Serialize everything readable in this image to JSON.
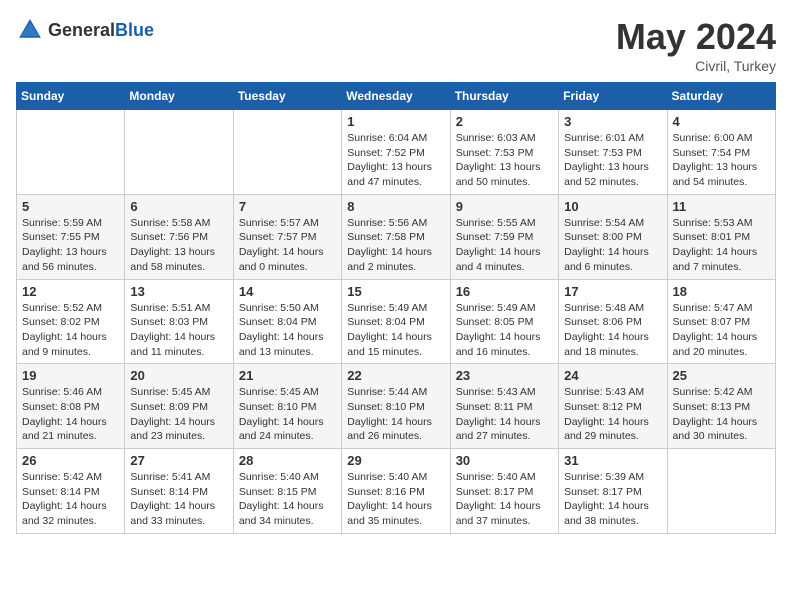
{
  "header": {
    "logo_general": "General",
    "logo_blue": "Blue",
    "month_year": "May 2024",
    "location": "Civril, Turkey"
  },
  "weekdays": [
    "Sunday",
    "Monday",
    "Tuesday",
    "Wednesday",
    "Thursday",
    "Friday",
    "Saturday"
  ],
  "weeks": [
    [
      null,
      null,
      null,
      {
        "day": "1",
        "sunrise": "Sunrise: 6:04 AM",
        "sunset": "Sunset: 7:52 PM",
        "daylight": "Daylight: 13 hours and 47 minutes."
      },
      {
        "day": "2",
        "sunrise": "Sunrise: 6:03 AM",
        "sunset": "Sunset: 7:53 PM",
        "daylight": "Daylight: 13 hours and 50 minutes."
      },
      {
        "day": "3",
        "sunrise": "Sunrise: 6:01 AM",
        "sunset": "Sunset: 7:53 PM",
        "daylight": "Daylight: 13 hours and 52 minutes."
      },
      {
        "day": "4",
        "sunrise": "Sunrise: 6:00 AM",
        "sunset": "Sunset: 7:54 PM",
        "daylight": "Daylight: 13 hours and 54 minutes."
      }
    ],
    [
      {
        "day": "5",
        "sunrise": "Sunrise: 5:59 AM",
        "sunset": "Sunset: 7:55 PM",
        "daylight": "Daylight: 13 hours and 56 minutes."
      },
      {
        "day": "6",
        "sunrise": "Sunrise: 5:58 AM",
        "sunset": "Sunset: 7:56 PM",
        "daylight": "Daylight: 13 hours and 58 minutes."
      },
      {
        "day": "7",
        "sunrise": "Sunrise: 5:57 AM",
        "sunset": "Sunset: 7:57 PM",
        "daylight": "Daylight: 14 hours and 0 minutes."
      },
      {
        "day": "8",
        "sunrise": "Sunrise: 5:56 AM",
        "sunset": "Sunset: 7:58 PM",
        "daylight": "Daylight: 14 hours and 2 minutes."
      },
      {
        "day": "9",
        "sunrise": "Sunrise: 5:55 AM",
        "sunset": "Sunset: 7:59 PM",
        "daylight": "Daylight: 14 hours and 4 minutes."
      },
      {
        "day": "10",
        "sunrise": "Sunrise: 5:54 AM",
        "sunset": "Sunset: 8:00 PM",
        "daylight": "Daylight: 14 hours and 6 minutes."
      },
      {
        "day": "11",
        "sunrise": "Sunrise: 5:53 AM",
        "sunset": "Sunset: 8:01 PM",
        "daylight": "Daylight: 14 hours and 7 minutes."
      }
    ],
    [
      {
        "day": "12",
        "sunrise": "Sunrise: 5:52 AM",
        "sunset": "Sunset: 8:02 PM",
        "daylight": "Daylight: 14 hours and 9 minutes."
      },
      {
        "day": "13",
        "sunrise": "Sunrise: 5:51 AM",
        "sunset": "Sunset: 8:03 PM",
        "daylight": "Daylight: 14 hours and 11 minutes."
      },
      {
        "day": "14",
        "sunrise": "Sunrise: 5:50 AM",
        "sunset": "Sunset: 8:04 PM",
        "daylight": "Daylight: 14 hours and 13 minutes."
      },
      {
        "day": "15",
        "sunrise": "Sunrise: 5:49 AM",
        "sunset": "Sunset: 8:04 PM",
        "daylight": "Daylight: 14 hours and 15 minutes."
      },
      {
        "day": "16",
        "sunrise": "Sunrise: 5:49 AM",
        "sunset": "Sunset: 8:05 PM",
        "daylight": "Daylight: 14 hours and 16 minutes."
      },
      {
        "day": "17",
        "sunrise": "Sunrise: 5:48 AM",
        "sunset": "Sunset: 8:06 PM",
        "daylight": "Daylight: 14 hours and 18 minutes."
      },
      {
        "day": "18",
        "sunrise": "Sunrise: 5:47 AM",
        "sunset": "Sunset: 8:07 PM",
        "daylight": "Daylight: 14 hours and 20 minutes."
      }
    ],
    [
      {
        "day": "19",
        "sunrise": "Sunrise: 5:46 AM",
        "sunset": "Sunset: 8:08 PM",
        "daylight": "Daylight: 14 hours and 21 minutes."
      },
      {
        "day": "20",
        "sunrise": "Sunrise: 5:45 AM",
        "sunset": "Sunset: 8:09 PM",
        "daylight": "Daylight: 14 hours and 23 minutes."
      },
      {
        "day": "21",
        "sunrise": "Sunrise: 5:45 AM",
        "sunset": "Sunset: 8:10 PM",
        "daylight": "Daylight: 14 hours and 24 minutes."
      },
      {
        "day": "22",
        "sunrise": "Sunrise: 5:44 AM",
        "sunset": "Sunset: 8:10 PM",
        "daylight": "Daylight: 14 hours and 26 minutes."
      },
      {
        "day": "23",
        "sunrise": "Sunrise: 5:43 AM",
        "sunset": "Sunset: 8:11 PM",
        "daylight": "Daylight: 14 hours and 27 minutes."
      },
      {
        "day": "24",
        "sunrise": "Sunrise: 5:43 AM",
        "sunset": "Sunset: 8:12 PM",
        "daylight": "Daylight: 14 hours and 29 minutes."
      },
      {
        "day": "25",
        "sunrise": "Sunrise: 5:42 AM",
        "sunset": "Sunset: 8:13 PM",
        "daylight": "Daylight: 14 hours and 30 minutes."
      }
    ],
    [
      {
        "day": "26",
        "sunrise": "Sunrise: 5:42 AM",
        "sunset": "Sunset: 8:14 PM",
        "daylight": "Daylight: 14 hours and 32 minutes."
      },
      {
        "day": "27",
        "sunrise": "Sunrise: 5:41 AM",
        "sunset": "Sunset: 8:14 PM",
        "daylight": "Daylight: 14 hours and 33 minutes."
      },
      {
        "day": "28",
        "sunrise": "Sunrise: 5:40 AM",
        "sunset": "Sunset: 8:15 PM",
        "daylight": "Daylight: 14 hours and 34 minutes."
      },
      {
        "day": "29",
        "sunrise": "Sunrise: 5:40 AM",
        "sunset": "Sunset: 8:16 PM",
        "daylight": "Daylight: 14 hours and 35 minutes."
      },
      {
        "day": "30",
        "sunrise": "Sunrise: 5:40 AM",
        "sunset": "Sunset: 8:17 PM",
        "daylight": "Daylight: 14 hours and 37 minutes."
      },
      {
        "day": "31",
        "sunrise": "Sunrise: 5:39 AM",
        "sunset": "Sunset: 8:17 PM",
        "daylight": "Daylight: 14 hours and 38 minutes."
      },
      null
    ]
  ]
}
